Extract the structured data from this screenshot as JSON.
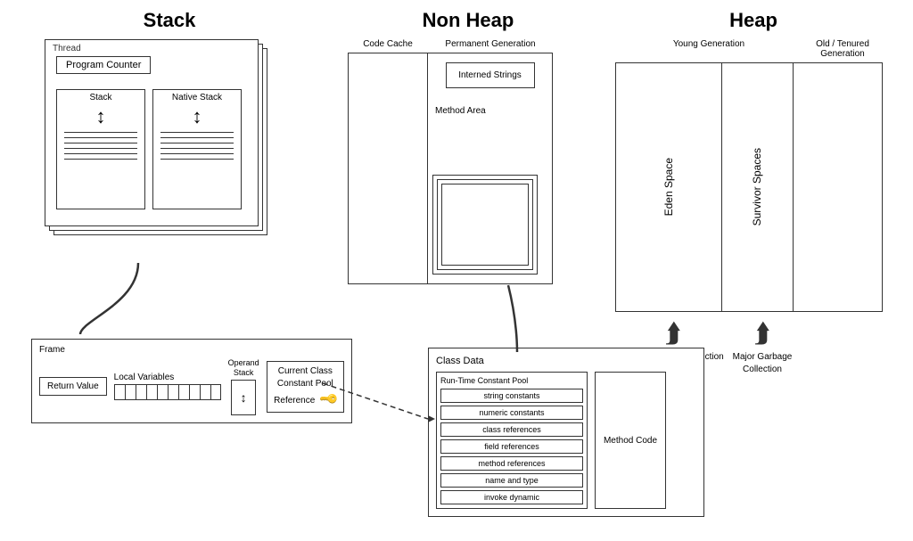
{
  "stack": {
    "title": "Stack",
    "thread_label": "Thread",
    "program_counter": "Program Counter",
    "stack_label": "Stack",
    "native_stack_label": "Native Stack",
    "frame_label": "Frame",
    "return_value_label": "Return Value",
    "local_vars_label": "Local Variables",
    "operand_stack_label": "Operand Stack",
    "current_class_label": "Current Class Constant Pool Reference"
  },
  "nonheap": {
    "title": "Non Heap",
    "code_cache_label": "Code Cache",
    "perm_gen_label": "Permanent Generation",
    "interned_strings_label": "Interned Strings",
    "method_area_label": "Method Area"
  },
  "heap": {
    "title": "Heap",
    "young_gen_label": "Young Generation",
    "old_gen_label": "Old / Tenured Generation",
    "eden_label": "Eden Space",
    "survivor_label": "Survivor Spaces",
    "minor_gc_label": "Minor Garbage Collection",
    "major_gc_label": "Major Garbage Collection"
  },
  "classdata": {
    "title": "Class Data",
    "runtime_cp_title": "Run-Time Constant Pool",
    "rows": [
      "string constants",
      "numeric constants",
      "class references",
      "field references",
      "method references",
      "name and type",
      "invoke dynamic"
    ],
    "method_code_label": "Method Code"
  }
}
